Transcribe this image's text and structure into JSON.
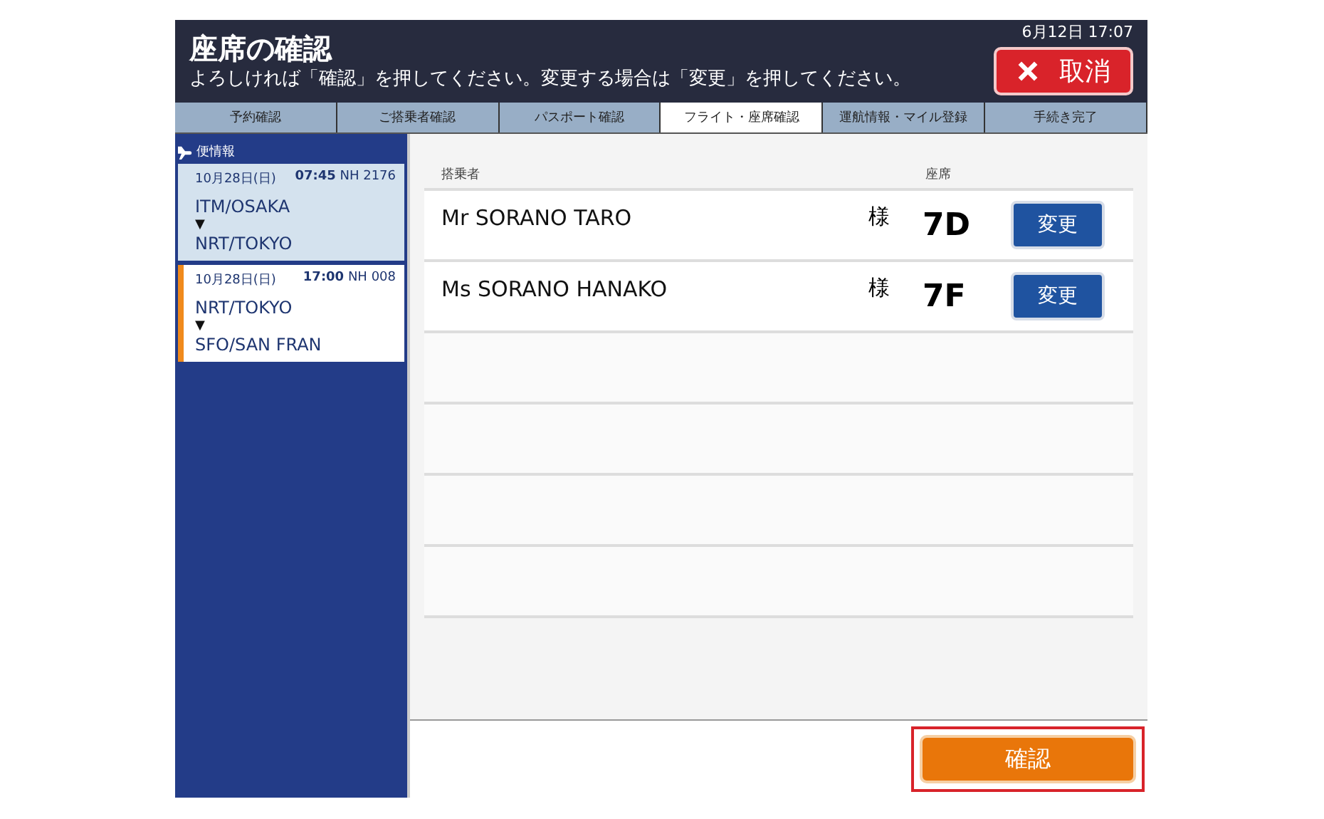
{
  "header": {
    "title": "座席の確認",
    "instruction": "よろしければ「確認」を押してください。変更する場合は「変更」を押してください。",
    "datetime": "6月12日  17:07",
    "cancel_button": "取消"
  },
  "steps": [
    {
      "label": "予約確認",
      "selected": false
    },
    {
      "label": "ご搭乗者確認",
      "selected": false
    },
    {
      "label": "パスポート確認",
      "selected": false
    },
    {
      "label": "フライト・座席確認",
      "selected": true
    },
    {
      "label": "運航情報・マイル登録",
      "selected": false
    },
    {
      "label": "手続き完了",
      "selected": false
    }
  ],
  "sidebar": {
    "title": "便情報",
    "flights": [
      {
        "date": "10月28日(日)",
        "time": "07:45",
        "flight": "NH 2176",
        "from": "ITM/OSAKA",
        "arrow": "▼",
        "to": "NRT/TOKYO",
        "selected": false
      },
      {
        "date": "10月28日(日)",
        "time": "17:00",
        "flight": "NH 008",
        "from": "NRT/TOKYO",
        "arrow": "▼",
        "to": "SFO/SAN FRAN",
        "selected": true
      }
    ]
  },
  "table": {
    "columns": [
      "搭乗者",
      "座席"
    ],
    "rows": [
      {
        "name": "Mr SORANO TARO",
        "honorific": "様",
        "seat": "7D",
        "button": "変更"
      },
      {
        "name": "Ms SORANO HANAKO",
        "honorific": "様",
        "seat": "7F",
        "button": "変更"
      }
    ]
  },
  "confirm_button": {
    "label": "確認",
    "highlighted": true
  }
}
